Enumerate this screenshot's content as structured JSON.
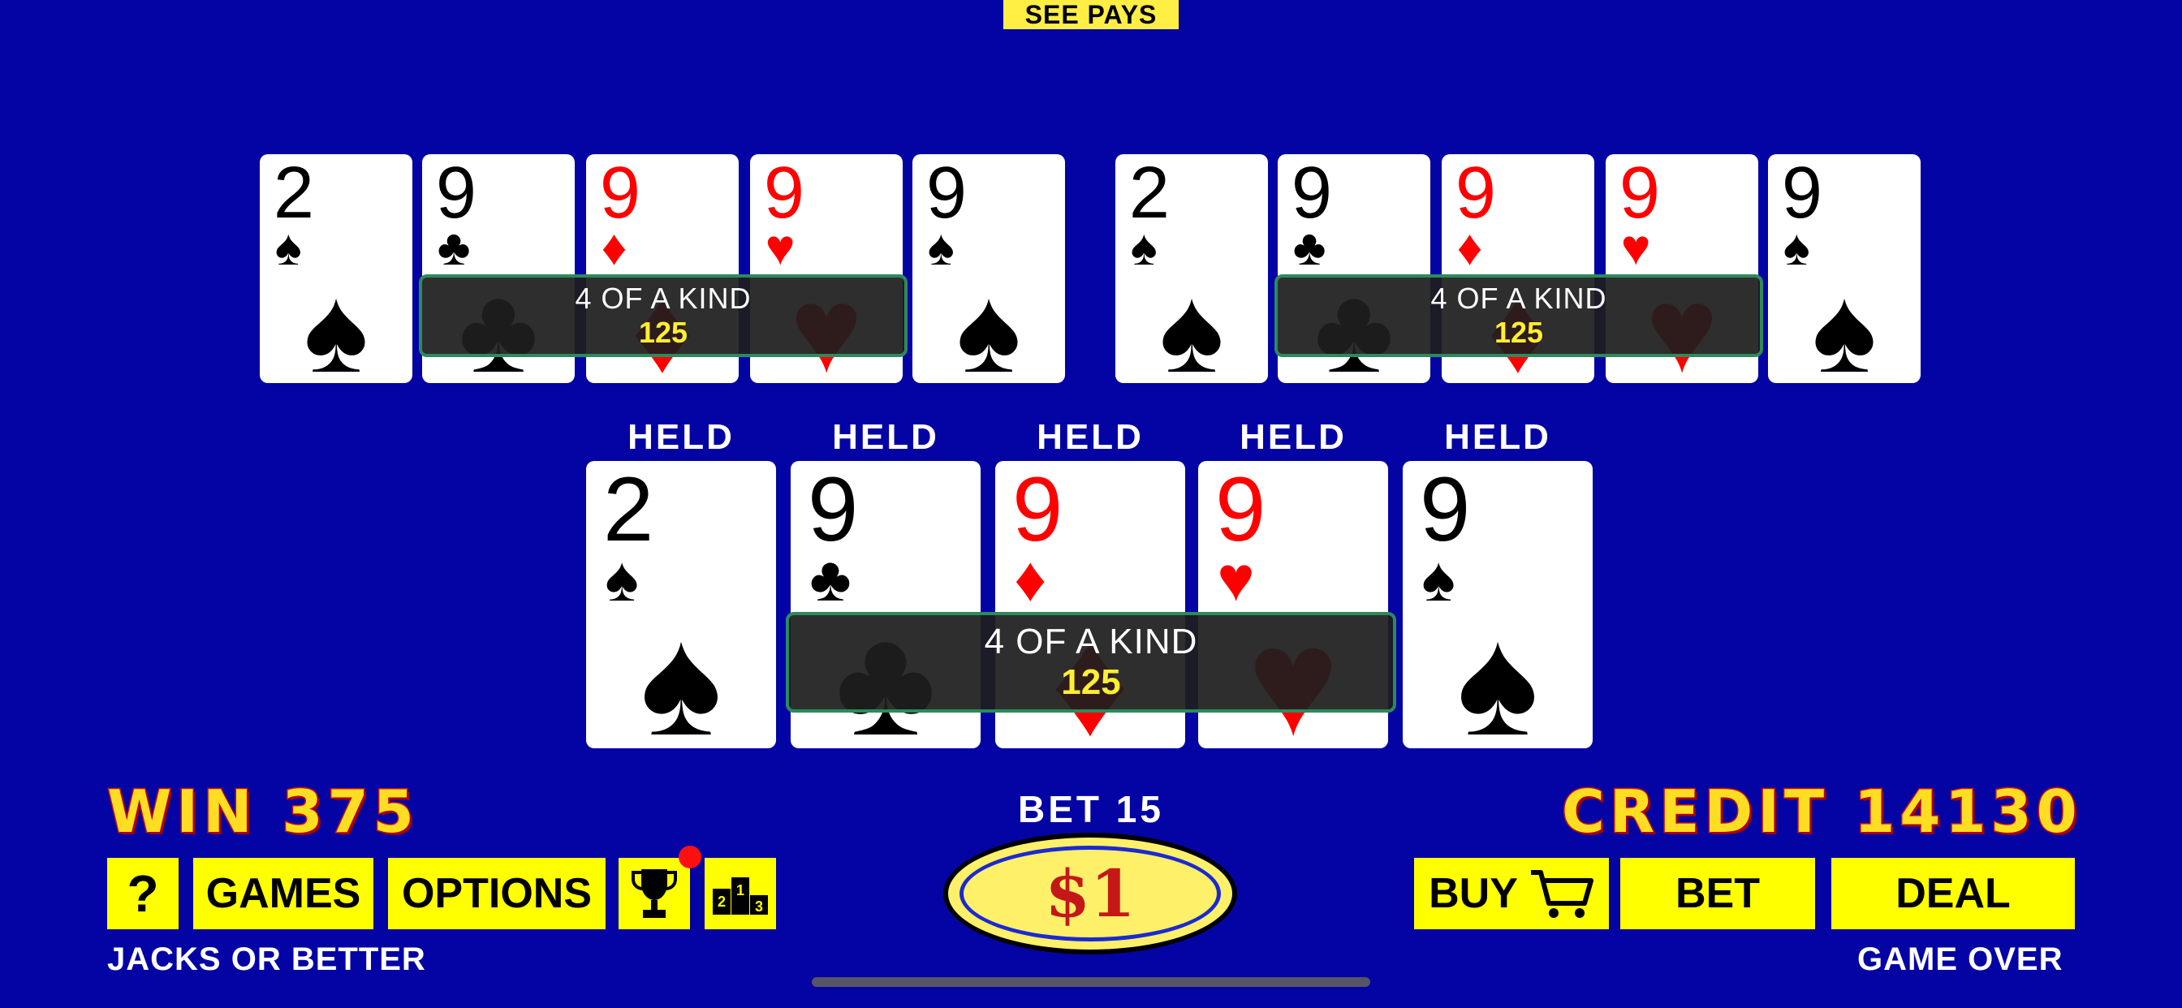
{
  "see_pays": "SEE PAYS",
  "hands": {
    "top_left": {
      "cards": [
        {
          "rank": "2",
          "suit": "♠",
          "color": "#000000"
        },
        {
          "rank": "9",
          "suit": "♣",
          "color": "#000000"
        },
        {
          "rank": "9",
          "suit": "♦",
          "color": "#ff0000"
        },
        {
          "rank": "9",
          "suit": "♥",
          "color": "#ff0000"
        },
        {
          "rank": "9",
          "suit": "♠",
          "color": "#000000"
        }
      ],
      "result": "4 OF A KIND",
      "payout": "125"
    },
    "top_right": {
      "cards": [
        {
          "rank": "2",
          "suit": "♠",
          "color": "#000000"
        },
        {
          "rank": "9",
          "suit": "♣",
          "color": "#000000"
        },
        {
          "rank": "9",
          "suit": "♦",
          "color": "#ff0000"
        },
        {
          "rank": "9",
          "suit": "♥",
          "color": "#ff0000"
        },
        {
          "rank": "9",
          "suit": "♠",
          "color": "#000000"
        }
      ],
      "result": "4 OF A KIND",
      "payout": "125"
    },
    "main": {
      "held_label": "HELD",
      "cards": [
        {
          "rank": "2",
          "suit": "♠",
          "color": "#000000"
        },
        {
          "rank": "9",
          "suit": "♣",
          "color": "#000000"
        },
        {
          "rank": "9",
          "suit": "♦",
          "color": "#ff0000"
        },
        {
          "rank": "9",
          "suit": "♥",
          "color": "#ff0000"
        },
        {
          "rank": "9",
          "suit": "♠",
          "color": "#000000"
        }
      ],
      "result": "4 OF A KIND",
      "payout": "125"
    }
  },
  "status": {
    "win": "WIN 375",
    "credit": "CREDIT 14130",
    "bet": "BET 15",
    "denomination": "$1",
    "game_name": "JACKS OR BETTER",
    "game_state": "GAME OVER"
  },
  "buttons": {
    "help": "?",
    "games": "GAMES",
    "options": "OPTIONS",
    "buy": "BUY",
    "bet": "BET",
    "deal": "DEAL"
  },
  "icons": {
    "trophy": "trophy-icon",
    "leaderboard": "leaderboard-podium-icon",
    "cart": "shopping-cart-icon"
  },
  "colors": {
    "background": "#0404a4",
    "button_yellow": "#ffff00",
    "label_gold": "#ffdd22",
    "label_outline": "#cc1111",
    "banner_border": "#2e8a5c",
    "payout_yellow": "#ffee33"
  }
}
